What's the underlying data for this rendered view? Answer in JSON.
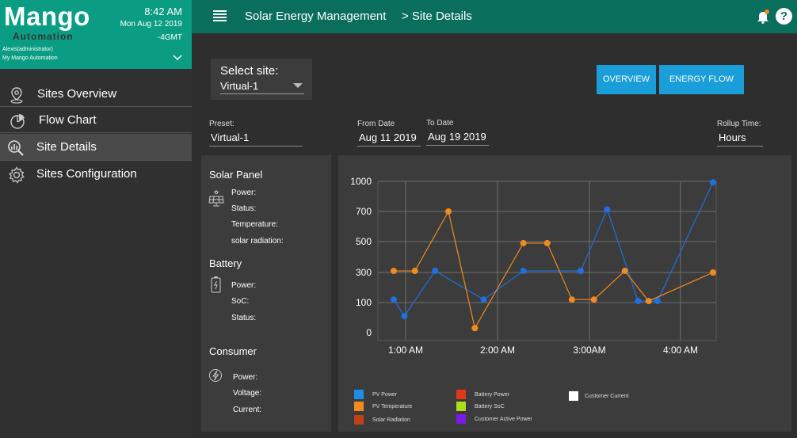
{
  "brand": {
    "name": "Mango",
    "subtitle": "Automation",
    "time": "8:42 AM",
    "date": "Mon Aug 12 2019",
    "timezone": "-4GMT",
    "user": "Alexis(administrator)",
    "workspace": "My Mango Automation"
  },
  "sidebar": {
    "items": [
      {
        "label": "Sites Overview",
        "icon": "map-pin-icon"
      },
      {
        "label": "Flow Chart",
        "icon": "pie-chart-icon"
      },
      {
        "label": "Site Details",
        "icon": "magnify-chart-icon",
        "active": true
      },
      {
        "label": "Sites Configuration",
        "icon": "gear-icon"
      }
    ]
  },
  "header": {
    "title": "Solar Energy Management",
    "breadcrumb": "> Site Details"
  },
  "site_select": {
    "label": "Select site:",
    "value": "Virtual-1"
  },
  "buttons": {
    "overview": "OVERVIEW",
    "energy_flow": "ENERGY FLOW"
  },
  "filters": {
    "preset_label": "Preset:",
    "preset_value": "Virtual-1",
    "from_label": "From Date",
    "from_value": "Aug 11 2019",
    "to_label": "To Date",
    "to_value": "Aug 19 2019",
    "rollup_label": "Rollup Time:",
    "rollup_value": "Hours"
  },
  "panel": {
    "solar": {
      "title": "Solar Panel",
      "props": [
        "Power:",
        "Status:",
        "Temperature:",
        "solar radiation:"
      ]
    },
    "battery": {
      "title": "Battery",
      "props": [
        "Power:",
        "SoC:",
        "Status:"
      ]
    },
    "consumer": {
      "title": "Consumer",
      "props": [
        "Power:",
        "Voltage:",
        "Current:"
      ]
    }
  },
  "colors": {
    "brand": "#0a9d84",
    "header": "#0a6e5c",
    "button": "#1a9ed9",
    "series_blue": "#1f6fe0",
    "series_orange": "#f28a1e"
  },
  "chart_data": {
    "type": "line",
    "y_ticks": [
      0,
      100,
      300,
      500,
      700,
      1000
    ],
    "x_tick_labels": [
      "1:00 AM",
      "2:00 AM",
      "3:00AM",
      "4:00 AM"
    ],
    "x_tick_hours": [
      1,
      2,
      3,
      4
    ],
    "xlim": [
      0.7,
      4.35
    ],
    "grid": true,
    "series": [
      {
        "name": "PV Power",
        "color": "#1f6fe0",
        "x": [
          0.73,
          0.85,
          1.2,
          1.55,
          1.75,
          2.2,
          2.5,
          2.85,
          3.15,
          3.5,
          3.72,
          4.35
        ],
        "y": [
          120,
          55,
          310,
          null,
          120,
          310,
          null,
          310,
          720,
          110,
          110,
          990
        ]
      },
      {
        "name": "PV Temperature",
        "color": "#f28a1e",
        "x": [
          0.73,
          0.97,
          1.35,
          1.65,
          1.85,
          2.2,
          2.47,
          2.75,
          3.0,
          3.35,
          3.62,
          4.35
        ],
        "y": [
          310,
          310,
          700,
          15,
          null,
          490,
          490,
          120,
          120,
          310,
          110,
          300
        ]
      }
    ],
    "legend": [
      {
        "label": "PV Power",
        "color": "#1a8fe8"
      },
      {
        "label": "PV Temperature",
        "color": "#f28a1e"
      },
      {
        "label": "Solar Radiation",
        "color": "#c0401a"
      },
      {
        "label": "Battery Power",
        "color": "#e0381a"
      },
      {
        "label": "Battery SoC",
        "color": "#a8e01a"
      },
      {
        "label": "Customer Active Power",
        "color": "#7a1ae8"
      },
      {
        "label": "Customer Current",
        "color": "#ffffff"
      }
    ]
  }
}
